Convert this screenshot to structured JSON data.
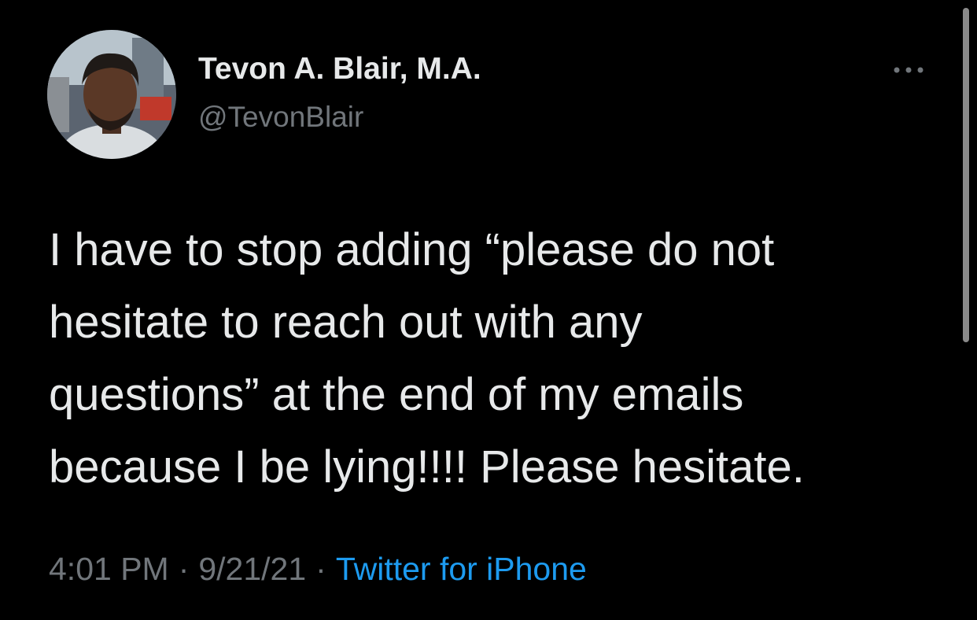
{
  "author": {
    "display_name": "Tevon A. Blair, M.A.",
    "handle": "@TevonBlair"
  },
  "tweet": {
    "lines": [
      "I have to stop adding “please do not",
      "hesitate to reach out with any",
      "questions” at the end of my emails",
      "because I be lying!!!! Please hesitate."
    ]
  },
  "meta": {
    "time": "4:01 PM",
    "separator": "·",
    "date": "9/21/21",
    "source": "Twitter for iPhone"
  },
  "icons": {
    "more": "more-horizontal-icon"
  },
  "colors": {
    "background": "#000000",
    "primary_text": "#e7e9ea",
    "secondary_text": "#71767b",
    "link": "#1d9bf0"
  }
}
